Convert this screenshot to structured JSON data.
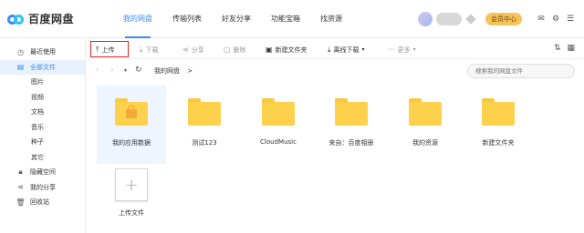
{
  "app": {
    "logo_text": "百度网盘"
  },
  "nav": [
    "我的网盘",
    "传输列表",
    "好友分享",
    "功能宝箱",
    "找资源"
  ],
  "header": {
    "vip_label": "会员中心"
  },
  "sidebar": {
    "items": [
      {
        "label": "最近使用",
        "icon": "clock-icon"
      },
      {
        "label": "全部文件",
        "icon": "file-icon"
      },
      {
        "label": "图片"
      },
      {
        "label": "视频"
      },
      {
        "label": "文档"
      },
      {
        "label": "音乐"
      },
      {
        "label": "种子"
      },
      {
        "label": "其它"
      },
      {
        "label": "隐藏空间",
        "icon": "lock-icon"
      },
      {
        "label": "我的分享",
        "icon": "share-icon"
      },
      {
        "label": "回收站",
        "icon": "trash-icon"
      }
    ]
  },
  "toolbar": {
    "upload": "上传",
    "download": "下载",
    "share": "分享",
    "delete": "删除",
    "new_folder": "新建文件夹",
    "offline_download": "离线下载",
    "more": "更多"
  },
  "path": {
    "current": "我的网盘",
    "separator": ">",
    "search_placeholder": "搜索我的网盘文件"
  },
  "files": [
    {
      "name": "我的应用数据",
      "locked": true
    },
    {
      "name": "测试123"
    },
    {
      "name": "CloudMusic"
    },
    {
      "name": "来自：百度相册"
    },
    {
      "name": "我的资源"
    },
    {
      "name": "新建文件夹"
    }
  ],
  "upload_tile": {
    "label": "上传文件"
  },
  "colors": {
    "accent": "#3b8cf2",
    "folder": "#fdd14c",
    "highlight": "#e02020"
  }
}
